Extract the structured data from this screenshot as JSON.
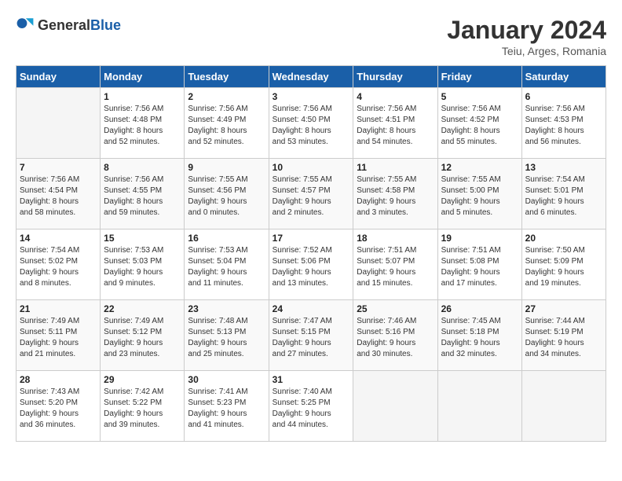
{
  "header": {
    "logo_general": "General",
    "logo_blue": "Blue",
    "month_title": "January 2024",
    "subtitle": "Teiu, Arges, Romania"
  },
  "weekdays": [
    "Sunday",
    "Monday",
    "Tuesday",
    "Wednesday",
    "Thursday",
    "Friday",
    "Saturday"
  ],
  "weeks": [
    [
      {
        "day": "",
        "info": ""
      },
      {
        "day": "1",
        "info": "Sunrise: 7:56 AM\nSunset: 4:48 PM\nDaylight: 8 hours\nand 52 minutes."
      },
      {
        "day": "2",
        "info": "Sunrise: 7:56 AM\nSunset: 4:49 PM\nDaylight: 8 hours\nand 52 minutes."
      },
      {
        "day": "3",
        "info": "Sunrise: 7:56 AM\nSunset: 4:50 PM\nDaylight: 8 hours\nand 53 minutes."
      },
      {
        "day": "4",
        "info": "Sunrise: 7:56 AM\nSunset: 4:51 PM\nDaylight: 8 hours\nand 54 minutes."
      },
      {
        "day": "5",
        "info": "Sunrise: 7:56 AM\nSunset: 4:52 PM\nDaylight: 8 hours\nand 55 minutes."
      },
      {
        "day": "6",
        "info": "Sunrise: 7:56 AM\nSunset: 4:53 PM\nDaylight: 8 hours\nand 56 minutes."
      }
    ],
    [
      {
        "day": "7",
        "info": "Sunrise: 7:56 AM\nSunset: 4:54 PM\nDaylight: 8 hours\nand 58 minutes."
      },
      {
        "day": "8",
        "info": "Sunrise: 7:56 AM\nSunset: 4:55 PM\nDaylight: 8 hours\nand 59 minutes."
      },
      {
        "day": "9",
        "info": "Sunrise: 7:55 AM\nSunset: 4:56 PM\nDaylight: 9 hours\nand 0 minutes."
      },
      {
        "day": "10",
        "info": "Sunrise: 7:55 AM\nSunset: 4:57 PM\nDaylight: 9 hours\nand 2 minutes."
      },
      {
        "day": "11",
        "info": "Sunrise: 7:55 AM\nSunset: 4:58 PM\nDaylight: 9 hours\nand 3 minutes."
      },
      {
        "day": "12",
        "info": "Sunrise: 7:55 AM\nSunset: 5:00 PM\nDaylight: 9 hours\nand 5 minutes."
      },
      {
        "day": "13",
        "info": "Sunrise: 7:54 AM\nSunset: 5:01 PM\nDaylight: 9 hours\nand 6 minutes."
      }
    ],
    [
      {
        "day": "14",
        "info": "Sunrise: 7:54 AM\nSunset: 5:02 PM\nDaylight: 9 hours\nand 8 minutes."
      },
      {
        "day": "15",
        "info": "Sunrise: 7:53 AM\nSunset: 5:03 PM\nDaylight: 9 hours\nand 9 minutes."
      },
      {
        "day": "16",
        "info": "Sunrise: 7:53 AM\nSunset: 5:04 PM\nDaylight: 9 hours\nand 11 minutes."
      },
      {
        "day": "17",
        "info": "Sunrise: 7:52 AM\nSunset: 5:06 PM\nDaylight: 9 hours\nand 13 minutes."
      },
      {
        "day": "18",
        "info": "Sunrise: 7:51 AM\nSunset: 5:07 PM\nDaylight: 9 hours\nand 15 minutes."
      },
      {
        "day": "19",
        "info": "Sunrise: 7:51 AM\nSunset: 5:08 PM\nDaylight: 9 hours\nand 17 minutes."
      },
      {
        "day": "20",
        "info": "Sunrise: 7:50 AM\nSunset: 5:09 PM\nDaylight: 9 hours\nand 19 minutes."
      }
    ],
    [
      {
        "day": "21",
        "info": "Sunrise: 7:49 AM\nSunset: 5:11 PM\nDaylight: 9 hours\nand 21 minutes."
      },
      {
        "day": "22",
        "info": "Sunrise: 7:49 AM\nSunset: 5:12 PM\nDaylight: 9 hours\nand 23 minutes."
      },
      {
        "day": "23",
        "info": "Sunrise: 7:48 AM\nSunset: 5:13 PM\nDaylight: 9 hours\nand 25 minutes."
      },
      {
        "day": "24",
        "info": "Sunrise: 7:47 AM\nSunset: 5:15 PM\nDaylight: 9 hours\nand 27 minutes."
      },
      {
        "day": "25",
        "info": "Sunrise: 7:46 AM\nSunset: 5:16 PM\nDaylight: 9 hours\nand 30 minutes."
      },
      {
        "day": "26",
        "info": "Sunrise: 7:45 AM\nSunset: 5:18 PM\nDaylight: 9 hours\nand 32 minutes."
      },
      {
        "day": "27",
        "info": "Sunrise: 7:44 AM\nSunset: 5:19 PM\nDaylight: 9 hours\nand 34 minutes."
      }
    ],
    [
      {
        "day": "28",
        "info": "Sunrise: 7:43 AM\nSunset: 5:20 PM\nDaylight: 9 hours\nand 36 minutes."
      },
      {
        "day": "29",
        "info": "Sunrise: 7:42 AM\nSunset: 5:22 PM\nDaylight: 9 hours\nand 39 minutes."
      },
      {
        "day": "30",
        "info": "Sunrise: 7:41 AM\nSunset: 5:23 PM\nDaylight: 9 hours\nand 41 minutes."
      },
      {
        "day": "31",
        "info": "Sunrise: 7:40 AM\nSunset: 5:25 PM\nDaylight: 9 hours\nand 44 minutes."
      },
      {
        "day": "",
        "info": ""
      },
      {
        "day": "",
        "info": ""
      },
      {
        "day": "",
        "info": ""
      }
    ]
  ]
}
